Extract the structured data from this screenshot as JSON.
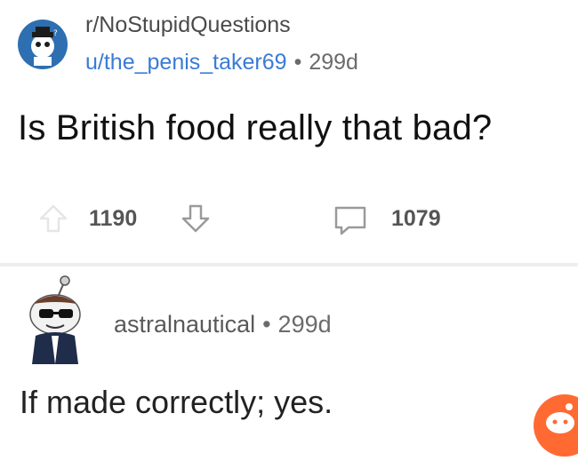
{
  "post": {
    "subreddit": "r/NoStupidQuestions",
    "author": "u/the_penis_taker69",
    "separator": "•",
    "age": "299d",
    "title": "Is British food really that bad?",
    "score": "1190",
    "comment_count": "1079"
  },
  "comment": {
    "author": "astralnautical",
    "separator": "•",
    "age": "299d",
    "body": "If made correctly; yes."
  },
  "icons": {
    "subreddit_avatar": "snoo-avatar-icon",
    "upvote": "upvote-arrow-icon",
    "downvote": "downvote-arrow-icon",
    "comments": "comment-bubble-icon",
    "user_avatar": "snoo-sunglasses-avatar-icon",
    "fab": "reddit-snoo-icon"
  },
  "colors": {
    "author_link": "#3a7bd5",
    "muted": "#6b6b6b",
    "accent": "#ff6a32",
    "subreddit_avatar_bg": "#2d6fb1"
  }
}
